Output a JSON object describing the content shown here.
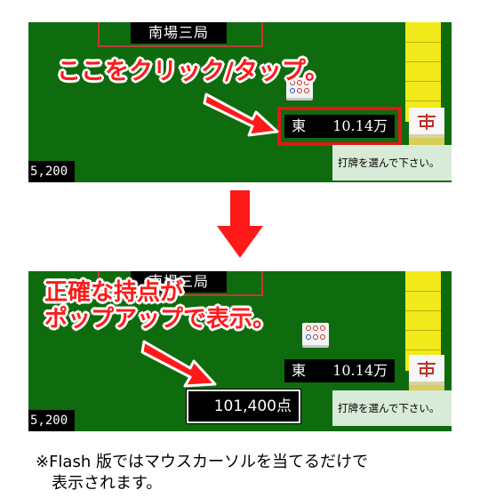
{
  "game": {
    "round_label": "南場三局",
    "player_wind": "東",
    "player_points_short": "10.14万",
    "player_points_exact": "101,400点",
    "left_player_points": "5,200",
    "status_message": "打牌を選んで下さい。"
  },
  "callouts": {
    "top": "ここをクリック/タップ。",
    "bottom_line1": "正確な持点が",
    "bottom_line2": "ポップアップで表示。"
  },
  "footnote": {
    "line1": "※Flash 版ではマウスカーソルを当てるだけで",
    "line2": "表示されます。"
  },
  "colors": {
    "table_green": "#0e6b0e",
    "highlight_red": "#e01818",
    "callout_red": "#ff1a1a",
    "wall_yellow": "#f2ea1a",
    "status_bg": "#d8ead8"
  },
  "icons": {
    "arrow_pointer": "red-arrow-icon",
    "arrow_down": "red-down-arrow-icon",
    "pin_tile": "circles-tile-icon",
    "east_tile": "east-wind-tile-icon"
  }
}
